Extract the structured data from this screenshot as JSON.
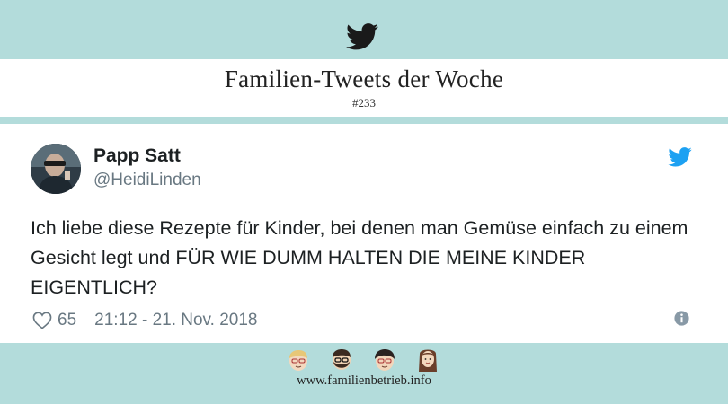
{
  "header": {
    "icon": "twitter-bird-icon",
    "title": "Familien-Tweets der Woche",
    "issue": "#233"
  },
  "tweet": {
    "author_name": "Papp Satt",
    "author_handle": "@HeidiLinden",
    "avatar_icon": "avatar-photo",
    "brand_icon": "twitter-bird-icon",
    "text": "Ich liebe diese Rezepte für Kinder, bei denen man Gemüse einfach zu einem Gesicht legt und FÜR WIE DUMM HALTEN DIE MEINE KINDER EIGENTLICH?",
    "likes": "65",
    "timestamp": "21:12 - 21. Nov. 2018",
    "heart_icon": "heart-icon",
    "info_icon": "info-icon"
  },
  "footer": {
    "faces": [
      "face-blonde-glasses-icon",
      "face-beard-glasses-icon",
      "face-dark-hair-glasses-icon",
      "face-long-hair-icon"
    ],
    "website": "www.familienbetrieb.info"
  },
  "colors": {
    "band": "#b3dcdb",
    "twitter_blue": "#1da1f2",
    "text": "#1c2022",
    "muted": "#697882"
  }
}
